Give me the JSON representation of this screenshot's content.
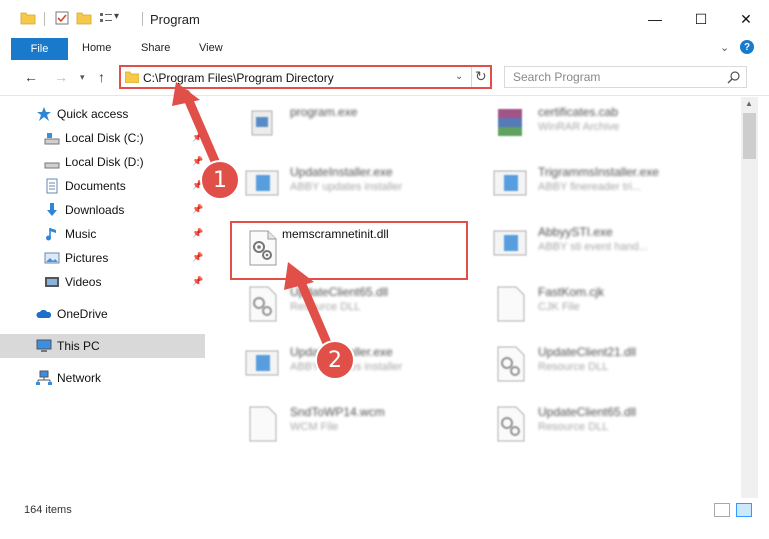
{
  "window": {
    "title": "Program",
    "min_glyph": "—",
    "max_glyph": "☐",
    "close_glyph": "✕"
  },
  "ribbon": {
    "file_tab": "File",
    "tabs": [
      "Home",
      "Share",
      "View"
    ],
    "help": "?"
  },
  "nav": {
    "address": "C:\\Program Files\\Program Directory",
    "search_placeholder": "Search Program"
  },
  "sidebar": {
    "items": [
      {
        "label": "Quick access",
        "icon": "star-icon"
      },
      {
        "label": "Local Disk (C:)",
        "icon": "drive-icon"
      },
      {
        "label": "Local Disk (D:)",
        "icon": "drive-icon"
      },
      {
        "label": "Documents",
        "icon": "documents-icon"
      },
      {
        "label": "Downloads",
        "icon": "downloads-icon"
      },
      {
        "label": "Music",
        "icon": "music-icon"
      },
      {
        "label": "Pictures",
        "icon": "pictures-icon"
      },
      {
        "label": "Videos",
        "icon": "videos-icon"
      },
      {
        "label": "OneDrive",
        "icon": "cloud-icon"
      },
      {
        "label": "This PC",
        "icon": "computer-icon"
      },
      {
        "label": "Network",
        "icon": "network-icon"
      }
    ]
  },
  "files": [
    {
      "name": "program.exe",
      "type": ""
    },
    {
      "name": "certificates.cab",
      "type": "WinRAR Archive"
    },
    {
      "name": "UpdateInstaller.exe",
      "type": "ABBY updates installer"
    },
    {
      "name": "TrigrammsInstaller.exe",
      "type": "ABBY finereader tri..."
    },
    {
      "name": "memscramnetinit.dll",
      "type": ""
    },
    {
      "name": "AbbyySTI.exe",
      "type": "ABBY sti event hand..."
    },
    {
      "name": "UpdateClient65.dll",
      "type": "Resource DLL"
    },
    {
      "name": "FastKom.cjk",
      "type": "CJK File"
    },
    {
      "name": "UpdateInstaller.exe",
      "type": "ABBY updates installer"
    },
    {
      "name": "UpdateClient21.dll",
      "type": "Resource DLL"
    },
    {
      "name": "SndToWP14.wcm",
      "type": "WCM File"
    },
    {
      "name": "UpdateClient65.dll",
      "type": "Resource DLL"
    }
  ],
  "status": {
    "item_count": "164 items"
  },
  "callouts": {
    "step1": "1",
    "step2": "2",
    "color": "#e05048"
  }
}
